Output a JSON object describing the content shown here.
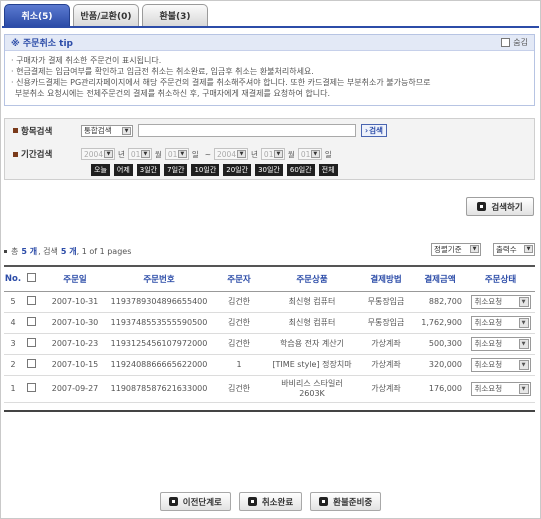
{
  "tabs": [
    {
      "label": "취소(5)",
      "active": true
    },
    {
      "label": "반품/교환(0)",
      "active": false
    },
    {
      "label": "환불(3)",
      "active": false
    }
  ],
  "tip": {
    "title": "※ 주문취소 tip",
    "hide_label": "숨김",
    "lines": [
      "· 구매자가 결제 취소한 주문건이 표시됩니다.",
      "· 현금결제는 입금여부를 확인하고 입금전 취소는 취소완료, 입금후 취소는 환불처리하세요.",
      "· 신용카드결제는 PG관리자페이지에서 해당 주문건의 결제를 취소해주셔야 합니다. 또한 카드결제는 부분취소가 불가능하므로",
      "  부분취소 요청시에는 전체주문건의 결제를 취소하신 후, 구매자에게 재결제를 요청하여 합니다."
    ]
  },
  "search": {
    "item_label": "항목검색",
    "item_select": "통합검색",
    "go_label": "검색",
    "period_label": "기간검색",
    "from": {
      "year": "2004",
      "year_unit": "년",
      "month": "01",
      "month_unit": "월",
      "day": "01",
      "day_unit": "일"
    },
    "tilde": "~",
    "to": {
      "year": "2004",
      "year_unit": "년",
      "month": "01",
      "month_unit": "월",
      "day": "01",
      "day_unit": "일"
    },
    "quick": [
      "오늘",
      "어제",
      "3일간",
      "7일간",
      "10일간",
      "20일간",
      "30일간",
      "60일간",
      "전체"
    ],
    "search_button": "검색하기"
  },
  "summary": {
    "prefix": "총",
    "total": "5 개",
    "sep": ", 검색",
    "found": "5 개",
    "pages": ", 1 of 1 pages"
  },
  "sort": {
    "sort_select": "정렬기준",
    "count_select": "출력수"
  },
  "table": {
    "headers": [
      "No.",
      "",
      "주문일",
      "주문번호",
      "주문자",
      "주문상품",
      "결제방법",
      "결제금액",
      "주문상태"
    ],
    "rows": [
      {
        "no": "5",
        "date": "2007-10-31",
        "order_no": "1193789304896655400",
        "buyer": "김건한",
        "product": "최신형 컴퓨터",
        "payment": "무통장입금",
        "amount": "882,700",
        "status": "취소요청"
      },
      {
        "no": "4",
        "date": "2007-10-30",
        "order_no": "1193748553555590500",
        "buyer": "김건한",
        "product": "최신형 컴퓨터",
        "payment": "무통장입금",
        "amount": "1,762,900",
        "status": "취소요청"
      },
      {
        "no": "3",
        "date": "2007-10-23",
        "order_no": "1193125456107972000",
        "buyer": "김건한",
        "product": "학습용 전자 계산기",
        "payment": "가상계좌",
        "amount": "500,300",
        "status": "취소요청"
      },
      {
        "no": "2",
        "date": "2007-10-15",
        "order_no": "1192408866665622000",
        "buyer": "1",
        "product": "[TIME style] 정장치마",
        "payment": "가상계좌",
        "amount": "320,000",
        "status": "취소요청"
      },
      {
        "no": "1",
        "date": "2007-09-27",
        "order_no": "1190878587621633000",
        "buyer": "김건한",
        "product": "바비리스 스타일러 2603K",
        "payment": "가상계좌",
        "amount": "176,000",
        "status": "취소요청"
      }
    ]
  },
  "actions": [
    "이전단계로",
    "취소완료",
    "환불준비중"
  ]
}
